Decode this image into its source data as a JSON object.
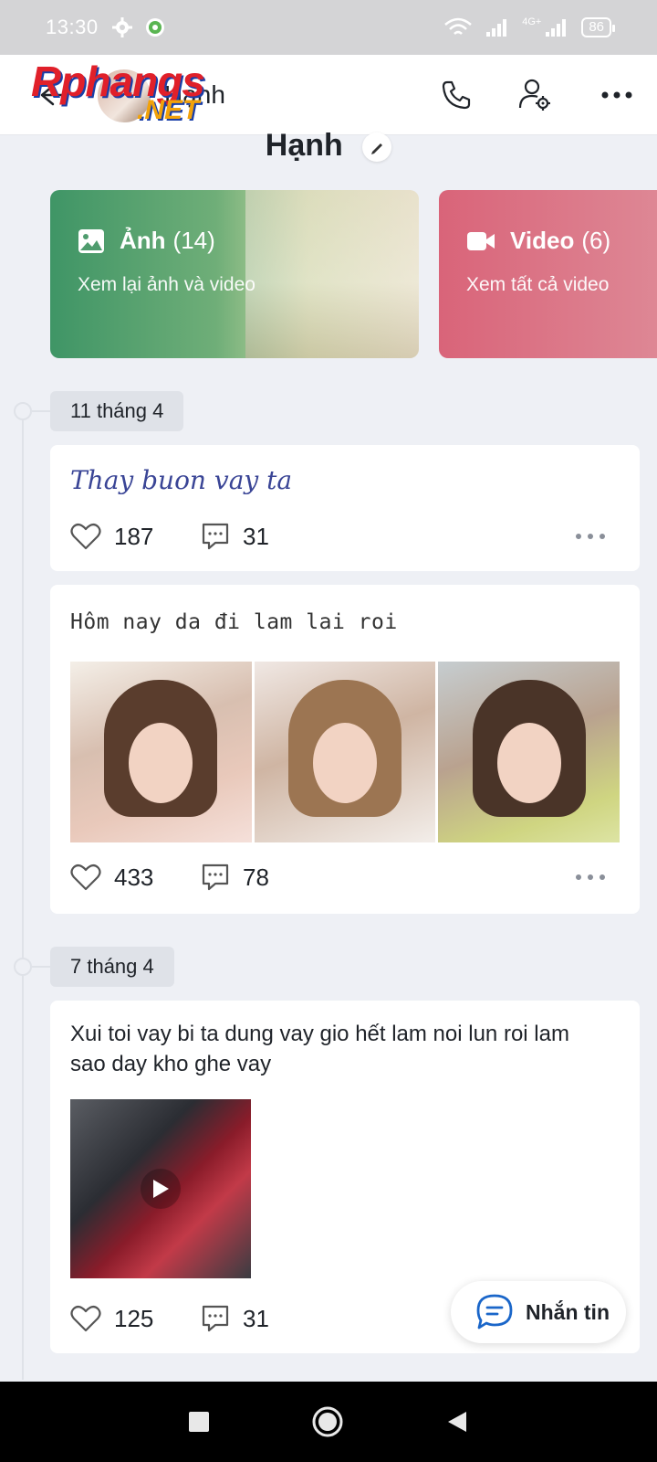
{
  "status_bar": {
    "time": "13:30",
    "network": "4G+",
    "battery": "86"
  },
  "header": {
    "title": "Hạnh",
    "watermark_main": "Rphangs",
    "watermark_sub": ".NET"
  },
  "profile": {
    "name": "Hạnh"
  },
  "media_cards": {
    "photos": {
      "label": "Ảnh",
      "count": "(14)",
      "subtitle": "Xem lại ảnh và video",
      "color": "#3f9566"
    },
    "videos": {
      "label": "Video",
      "count": "(6)",
      "subtitle": "Xem tất cả video",
      "color": "#d96479"
    }
  },
  "timeline": {
    "groups": [
      {
        "date": "11 tháng 4"
      },
      {
        "date": "7 tháng 4"
      }
    ]
  },
  "posts": [
    {
      "text": "Thay buon vay ta",
      "likes": "187",
      "comments": "31"
    },
    {
      "text": "Hôm nay da đi lam lai roi",
      "likes": "433",
      "comments": "78"
    },
    {
      "text": "Xui toi vay bi ta dung vay gio hết lam noi lun roi lam sao day kho ghe vay",
      "likes": "125",
      "comments": "31"
    }
  ],
  "message_button": {
    "label": "Nhắn tin"
  },
  "accent_color": "#1a66c9"
}
